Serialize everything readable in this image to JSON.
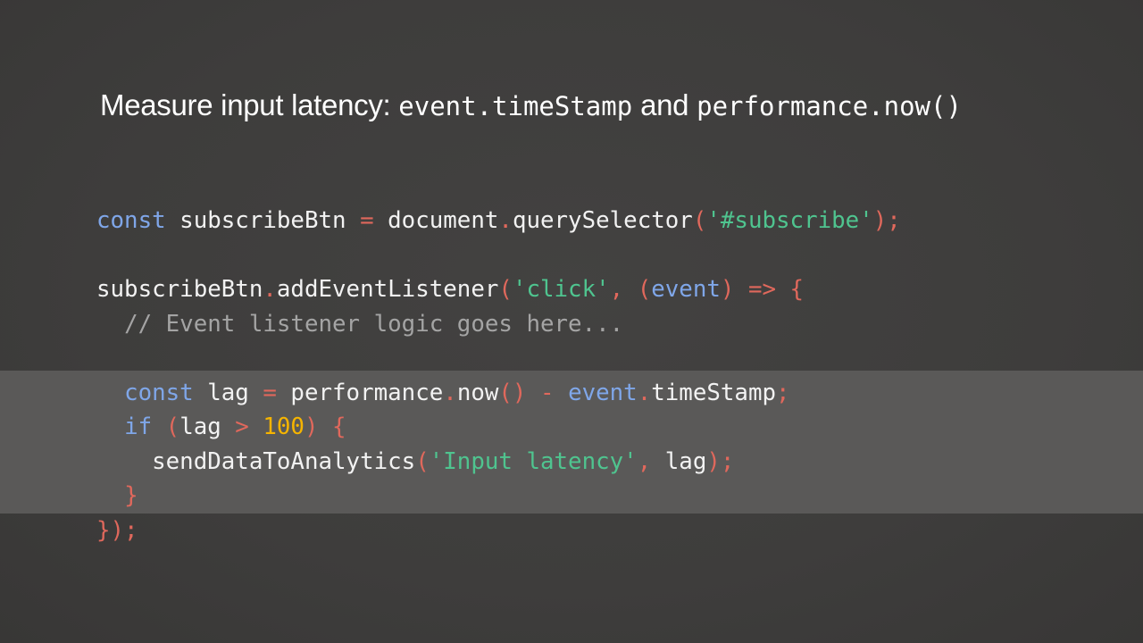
{
  "title": {
    "text_1": "Measure input latency: ",
    "code_1": "event.timeStamp",
    "text_2": " and ",
    "code_2": "performance.now()"
  },
  "code": {
    "line1": {
      "kw": "const",
      "var": " subscribeBtn ",
      "eq": "=",
      "obj": " document",
      "dot": ".",
      "fn": "querySelector",
      "open": "(",
      "str": "'#subscribe'",
      "close": ");"
    },
    "line2": {
      "obj": "subscribeBtn",
      "dot": ".",
      "fn": "addEventListener",
      "open": "(",
      "str": "'click'",
      "comma": ", (",
      "param": "event",
      "arrow": ") => {"
    },
    "line3": {
      "indent": "  ",
      "comment": "// Event listener logic goes here..."
    },
    "line4": {
      "indent": "  ",
      "kw": "const",
      "var": " lag ",
      "eq": "=",
      "obj": " performance",
      "dot": ".",
      "fn": "now",
      "parens": "() - ",
      "ev": "event",
      "dot2": ".",
      "prop": "timeStamp",
      "semi": ";"
    },
    "line5": {
      "indent": "  ",
      "kw": "if",
      "open": " (",
      "var": "lag",
      "gt": " > ",
      "num": "100",
      "close": ") {"
    },
    "line6": {
      "indent": "    ",
      "fn": "sendDataToAnalytics",
      "open": "(",
      "str": "'Input latency'",
      "comma": ", ",
      "var": "lag",
      "close": ");"
    },
    "line7": {
      "indent": "  ",
      "brace": "}"
    },
    "line8": {
      "close": "});"
    }
  },
  "colors": {
    "background": "#3f3e3d",
    "highlight": "#5a5958",
    "keyword": "#7fa6e8",
    "punctuation": "#e0685c",
    "string": "#4fc48f",
    "comment": "#a4a4a4",
    "number": "#f5b400",
    "text": "#f2f2f2"
  }
}
